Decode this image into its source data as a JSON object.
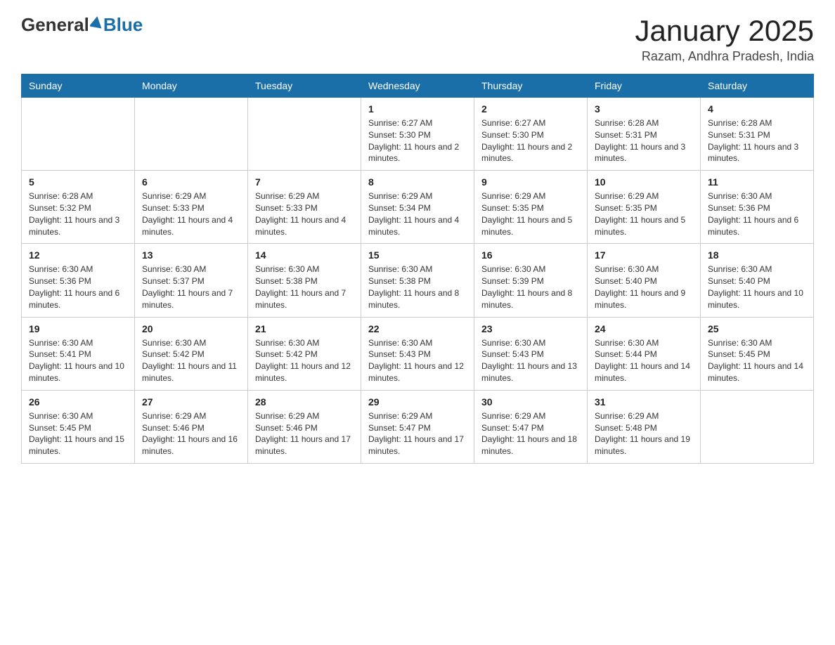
{
  "logo": {
    "general": "General",
    "blue": "Blue"
  },
  "title": "January 2025",
  "location": "Razam, Andhra Pradesh, India",
  "headers": [
    "Sunday",
    "Monday",
    "Tuesday",
    "Wednesday",
    "Thursday",
    "Friday",
    "Saturday"
  ],
  "weeks": [
    [
      {
        "day": "",
        "info": ""
      },
      {
        "day": "",
        "info": ""
      },
      {
        "day": "",
        "info": ""
      },
      {
        "day": "1",
        "info": "Sunrise: 6:27 AM\nSunset: 5:30 PM\nDaylight: 11 hours and 2 minutes."
      },
      {
        "day": "2",
        "info": "Sunrise: 6:27 AM\nSunset: 5:30 PM\nDaylight: 11 hours and 2 minutes."
      },
      {
        "day": "3",
        "info": "Sunrise: 6:28 AM\nSunset: 5:31 PM\nDaylight: 11 hours and 3 minutes."
      },
      {
        "day": "4",
        "info": "Sunrise: 6:28 AM\nSunset: 5:31 PM\nDaylight: 11 hours and 3 minutes."
      }
    ],
    [
      {
        "day": "5",
        "info": "Sunrise: 6:28 AM\nSunset: 5:32 PM\nDaylight: 11 hours and 3 minutes."
      },
      {
        "day": "6",
        "info": "Sunrise: 6:29 AM\nSunset: 5:33 PM\nDaylight: 11 hours and 4 minutes."
      },
      {
        "day": "7",
        "info": "Sunrise: 6:29 AM\nSunset: 5:33 PM\nDaylight: 11 hours and 4 minutes."
      },
      {
        "day": "8",
        "info": "Sunrise: 6:29 AM\nSunset: 5:34 PM\nDaylight: 11 hours and 4 minutes."
      },
      {
        "day": "9",
        "info": "Sunrise: 6:29 AM\nSunset: 5:35 PM\nDaylight: 11 hours and 5 minutes."
      },
      {
        "day": "10",
        "info": "Sunrise: 6:29 AM\nSunset: 5:35 PM\nDaylight: 11 hours and 5 minutes."
      },
      {
        "day": "11",
        "info": "Sunrise: 6:30 AM\nSunset: 5:36 PM\nDaylight: 11 hours and 6 minutes."
      }
    ],
    [
      {
        "day": "12",
        "info": "Sunrise: 6:30 AM\nSunset: 5:36 PM\nDaylight: 11 hours and 6 minutes."
      },
      {
        "day": "13",
        "info": "Sunrise: 6:30 AM\nSunset: 5:37 PM\nDaylight: 11 hours and 7 minutes."
      },
      {
        "day": "14",
        "info": "Sunrise: 6:30 AM\nSunset: 5:38 PM\nDaylight: 11 hours and 7 minutes."
      },
      {
        "day": "15",
        "info": "Sunrise: 6:30 AM\nSunset: 5:38 PM\nDaylight: 11 hours and 8 minutes."
      },
      {
        "day": "16",
        "info": "Sunrise: 6:30 AM\nSunset: 5:39 PM\nDaylight: 11 hours and 8 minutes."
      },
      {
        "day": "17",
        "info": "Sunrise: 6:30 AM\nSunset: 5:40 PM\nDaylight: 11 hours and 9 minutes."
      },
      {
        "day": "18",
        "info": "Sunrise: 6:30 AM\nSunset: 5:40 PM\nDaylight: 11 hours and 10 minutes."
      }
    ],
    [
      {
        "day": "19",
        "info": "Sunrise: 6:30 AM\nSunset: 5:41 PM\nDaylight: 11 hours and 10 minutes."
      },
      {
        "day": "20",
        "info": "Sunrise: 6:30 AM\nSunset: 5:42 PM\nDaylight: 11 hours and 11 minutes."
      },
      {
        "day": "21",
        "info": "Sunrise: 6:30 AM\nSunset: 5:42 PM\nDaylight: 11 hours and 12 minutes."
      },
      {
        "day": "22",
        "info": "Sunrise: 6:30 AM\nSunset: 5:43 PM\nDaylight: 11 hours and 12 minutes."
      },
      {
        "day": "23",
        "info": "Sunrise: 6:30 AM\nSunset: 5:43 PM\nDaylight: 11 hours and 13 minutes."
      },
      {
        "day": "24",
        "info": "Sunrise: 6:30 AM\nSunset: 5:44 PM\nDaylight: 11 hours and 14 minutes."
      },
      {
        "day": "25",
        "info": "Sunrise: 6:30 AM\nSunset: 5:45 PM\nDaylight: 11 hours and 14 minutes."
      }
    ],
    [
      {
        "day": "26",
        "info": "Sunrise: 6:30 AM\nSunset: 5:45 PM\nDaylight: 11 hours and 15 minutes."
      },
      {
        "day": "27",
        "info": "Sunrise: 6:29 AM\nSunset: 5:46 PM\nDaylight: 11 hours and 16 minutes."
      },
      {
        "day": "28",
        "info": "Sunrise: 6:29 AM\nSunset: 5:46 PM\nDaylight: 11 hours and 17 minutes."
      },
      {
        "day": "29",
        "info": "Sunrise: 6:29 AM\nSunset: 5:47 PM\nDaylight: 11 hours and 17 minutes."
      },
      {
        "day": "30",
        "info": "Sunrise: 6:29 AM\nSunset: 5:47 PM\nDaylight: 11 hours and 18 minutes."
      },
      {
        "day": "31",
        "info": "Sunrise: 6:29 AM\nSunset: 5:48 PM\nDaylight: 11 hours and 19 minutes."
      },
      {
        "day": "",
        "info": ""
      }
    ]
  ]
}
